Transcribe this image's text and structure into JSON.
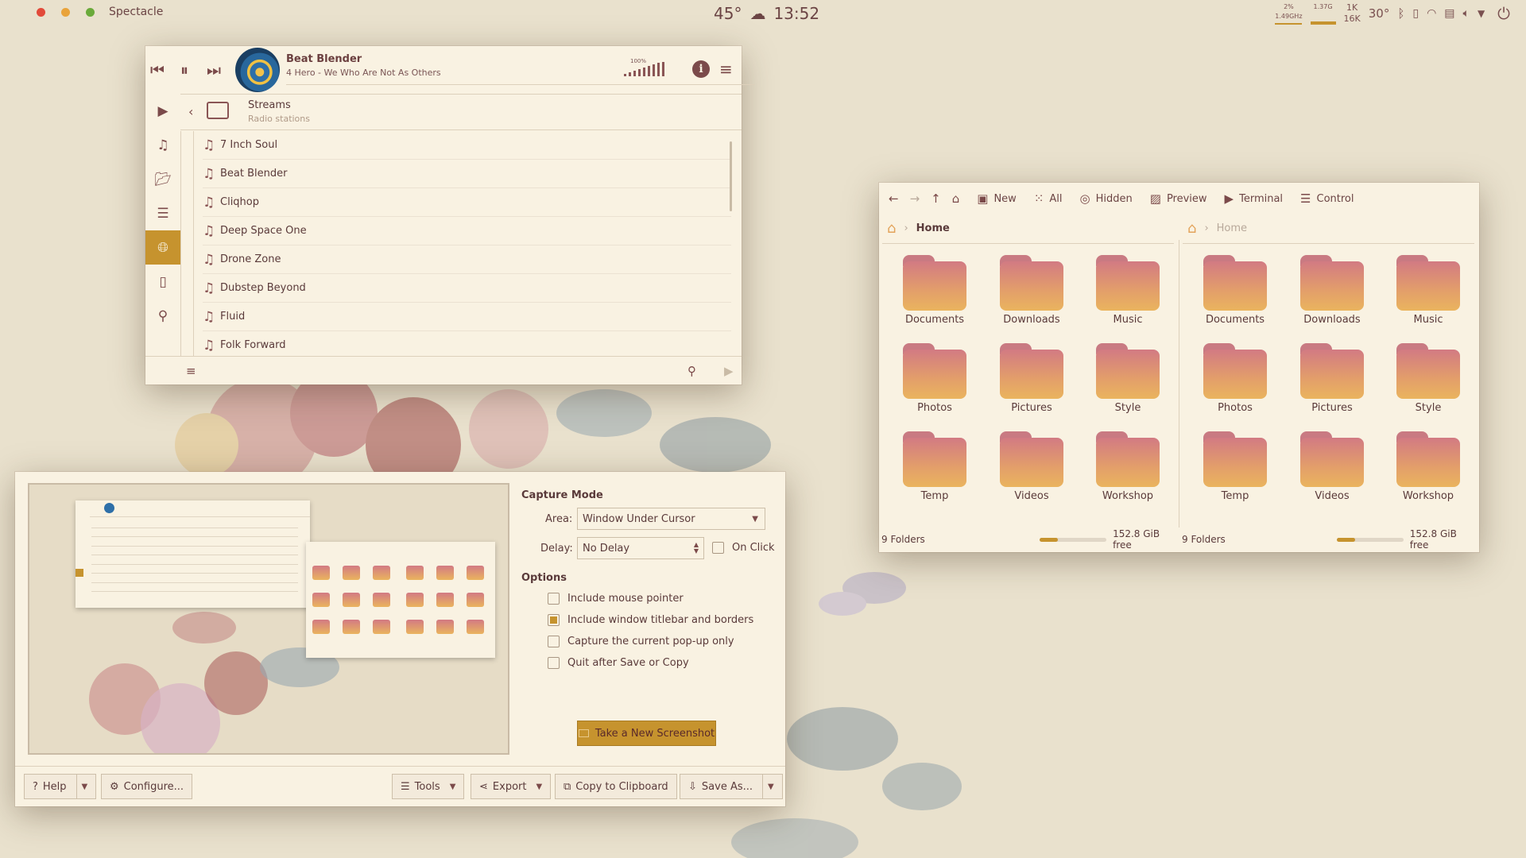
{
  "topbar": {
    "app_name": "Spectacle",
    "weather_temp": "45°",
    "clock": "13:52",
    "cpu_pct": "2%",
    "cpu_freq": "1.49GHz",
    "mem": "1.37G",
    "net_up": "1K",
    "net_down": "16K",
    "sensor_temp": "30°"
  },
  "player": {
    "station": "Beat Blender",
    "now_playing": "4 Hero - We Who Are Not As Others",
    "volume_label": "100%",
    "crumb_title": "Streams",
    "crumb_subtitle": "Radio stations",
    "stations": [
      "7 Inch Soul",
      "Beat Blender",
      "Cliqhop",
      "Deep Space One",
      "Drone Zone",
      "Dubstep Beyond",
      "Fluid",
      "Folk Forward"
    ]
  },
  "files": {
    "toolbar": {
      "new": "New",
      "all": "All",
      "hidden": "Hidden",
      "preview": "Preview",
      "terminal": "Terminal",
      "control": "Control"
    },
    "left": {
      "crumb": "Home",
      "folders": [
        "Documents",
        "Downloads",
        "Music",
        "Photos",
        "Pictures",
        "Style",
        "Temp",
        "Videos",
        "Workshop"
      ],
      "status": "9 Folders",
      "free": "152.8 GiB free"
    },
    "right": {
      "crumb": "Home",
      "folders": [
        "Documents",
        "Downloads",
        "Music",
        "Photos",
        "Pictures",
        "Style",
        "Temp",
        "Videos",
        "Workshop"
      ],
      "status": "9 Folders",
      "free": "152.8 GiB free"
    },
    "disk_used_fraction": 0.28
  },
  "spectacle": {
    "capture_mode_heading": "Capture Mode",
    "area_label": "Area:",
    "area_value": "Window Under Cursor",
    "delay_label": "Delay:",
    "delay_value": "No Delay",
    "on_click": "On Click",
    "options_heading": "Options",
    "options": [
      {
        "label": "Include mouse pointer",
        "checked": false
      },
      {
        "label": "Include window titlebar and borders",
        "checked": true
      },
      {
        "label": "Capture the current pop-up only",
        "checked": false
      },
      {
        "label": "Quit after Save or Copy",
        "checked": false
      }
    ],
    "take_button": "Take a New Screenshot",
    "footer": {
      "help": "Help",
      "configure": "Configure...",
      "tools": "Tools",
      "export": "Export",
      "copy": "Copy to Clipboard",
      "save_as": "Save As..."
    }
  },
  "colors": {
    "accent": "#c6932e",
    "text": "#5a3a3a",
    "window_bg": "#f9f2e2",
    "desktop_bg": "#e9e1cd"
  }
}
